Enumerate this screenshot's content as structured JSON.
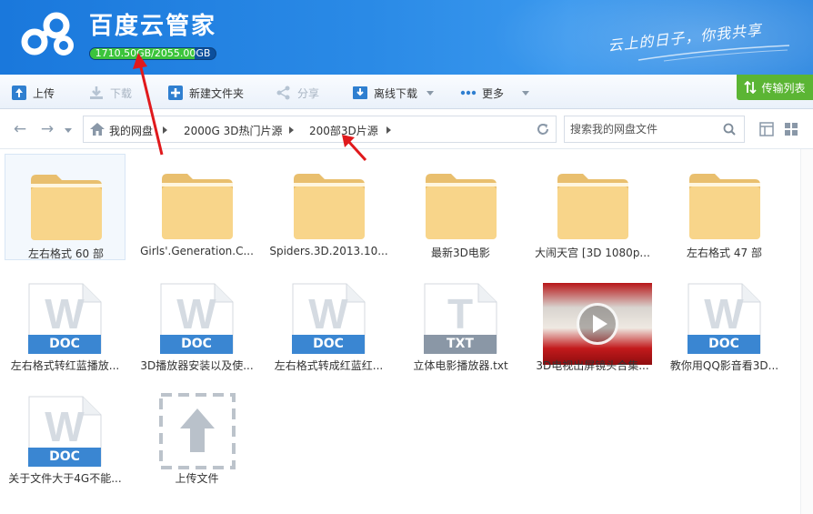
{
  "app": {
    "title": "百度云管家",
    "quota_text": "1710.50GB/2055.00GB",
    "quota_fraction": 0.8324,
    "slogan": "云上的日子，你我共享"
  },
  "toolbar": {
    "upload": "上传",
    "download": "下载",
    "new_folder": "新建文件夹",
    "share": "分享",
    "offline_download": "离线下载",
    "more": "更多",
    "transfer_list": "传输列表"
  },
  "breadcrumb": {
    "items": [
      "我的网盘",
      "2000G 3D热门片源",
      "200部3D片源"
    ]
  },
  "search": {
    "placeholder": "搜索我的网盘文件"
  },
  "files": [
    {
      "type": "folder",
      "label": "左右格式 60 部"
    },
    {
      "type": "folder",
      "label": "Girls'.Generation.C..."
    },
    {
      "type": "folder",
      "label": "Spiders.3D.2013.10..."
    },
    {
      "type": "folder",
      "label": "最新3D电影"
    },
    {
      "type": "folder",
      "label": "大闹天宫 [3D 1080p..."
    },
    {
      "type": "folder",
      "label": "左右格式 47 部"
    },
    {
      "type": "doc",
      "badge": "DOC",
      "label": "左右格式转红蓝播放..."
    },
    {
      "type": "doc",
      "badge": "DOC",
      "label": "3D播放器安装以及使..."
    },
    {
      "type": "doc",
      "badge": "DOC",
      "label": "左右格式转成红蓝红..."
    },
    {
      "type": "txt",
      "badge": "TXT",
      "label": "立体电影播放器.txt"
    },
    {
      "type": "video",
      "label": "3D电视出屏镜头合集..."
    },
    {
      "type": "doc",
      "badge": "DOC",
      "label": "教你用QQ影音看3D..."
    },
    {
      "type": "doc",
      "badge": "DOC",
      "label": "关于文件大于4G不能..."
    },
    {
      "type": "upload",
      "label": "上传文件"
    }
  ],
  "colors": {
    "header_blue": "#2a8ae6",
    "quota_green": "#3cc43c",
    "transfer_green": "#5bb534",
    "doc_blue": "#3a86d2",
    "folder_yellow": "#f8d58a",
    "annotation_red": "#e0191c"
  }
}
